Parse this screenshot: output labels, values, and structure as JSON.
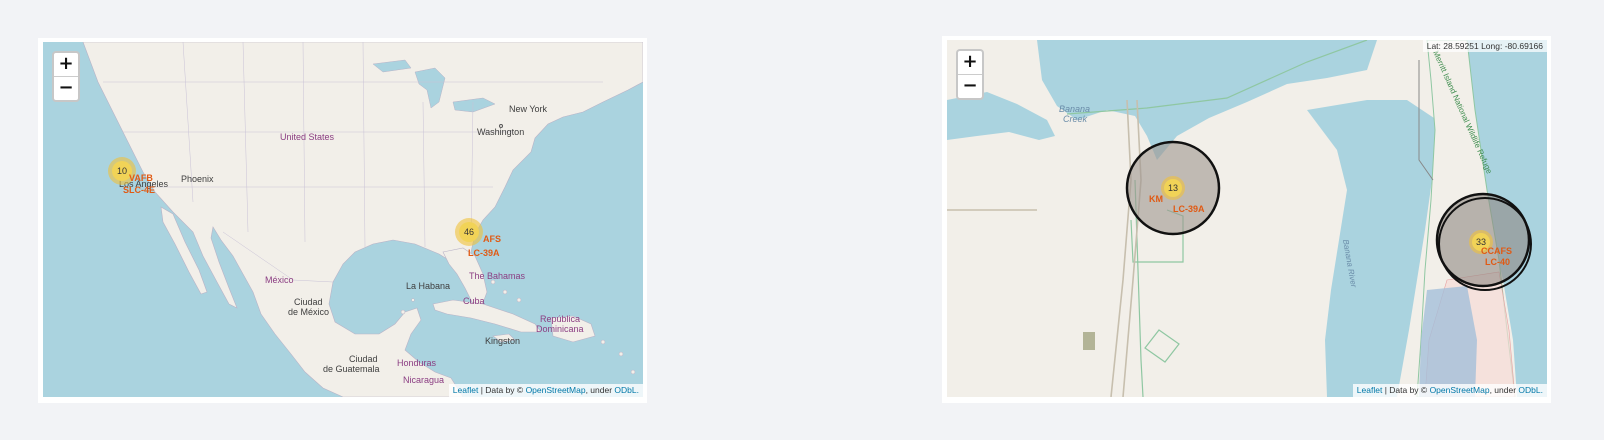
{
  "map1": {
    "zoom_in_label": "+",
    "zoom_out_label": "−",
    "places": {
      "new_york": "New York",
      "washington": "Washington",
      "united_states": "United States",
      "phoenix": "Phoenix",
      "los_angeles": "Los Angeles",
      "mexico": "México",
      "ciudad_de_mexico_1": "Ciudad",
      "ciudad_de_mexico_2": "de México",
      "la_habana": "La Habana",
      "cuba": "Cuba",
      "the_bahamas": "The Bahamas",
      "republica_dominicana_1": "República",
      "republica_dominicana_2": "Dominicana",
      "kingston": "Kingston",
      "ciudad_de_guatemala_1": "Ciudad",
      "ciudad_de_guatemala_2": "de Guatemala",
      "honduras": "Honduras",
      "nicaragua": "Nicaragua"
    },
    "clusters": [
      {
        "count": "10",
        "labels": [
          "VAFB",
          "SLC-4E"
        ]
      },
      {
        "count": "46",
        "labels": [
          "AFS",
          "LC-39A"
        ]
      }
    ],
    "attribution": {
      "leaflet": "Leaflet",
      "data_by": "| Data by ©",
      "osm": "OpenStreetMap",
      "under": ", under",
      "odbl": "ODbL."
    }
  },
  "map2": {
    "zoom_in_label": "+",
    "zoom_out_label": "−",
    "coords": "Lat: 28.59251 Long: -80.69166",
    "places": {
      "banana_creek_1": "Banana",
      "banana_creek_2": "Creek",
      "wildlife_refuge": "Merritt Island National Wildlife Refuge",
      "banana_river": "Banana River"
    },
    "clusters": [
      {
        "count": "13",
        "labels": [
          "KM",
          "LC-39A"
        ]
      },
      {
        "count": "33",
        "labels": [
          "CCAFS",
          "LC-40"
        ]
      }
    ],
    "attribution": {
      "leaflet": "Leaflet",
      "data_by": "| Data by ©",
      "osm": "OpenStreetMap",
      "under": ", under",
      "odbl": "ODbL."
    }
  },
  "colors": {
    "water": "#aad3df",
    "land": "#f2efe9",
    "cluster_fill": "#f1d357",
    "cluster_halo": "#f0c23a",
    "site_label": "#e05a14",
    "link": "#0078a8"
  }
}
